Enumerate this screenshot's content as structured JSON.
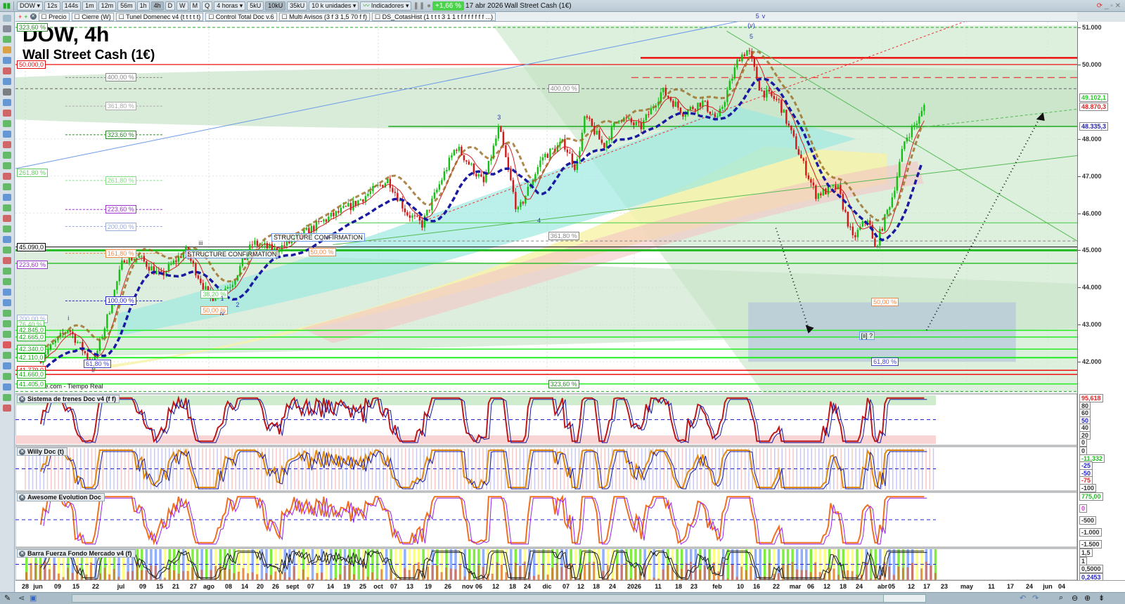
{
  "toolbar": {
    "symbol": "DOW",
    "intervals": [
      "12s",
      "144s",
      "1m",
      "12m",
      "56m",
      "1h",
      "4h",
      "D",
      "W",
      "M",
      "Q"
    ],
    "active_interval": "4h",
    "period": "4 horas",
    "units_buttons": [
      "5kU",
      "10kU",
      "35kU"
    ],
    "active_units": "10kU",
    "units": "10 k unidades",
    "indicators": "Indicadores",
    "change": "+1,66 %",
    "date": "17 abr 2026",
    "instrument": "Wall Street Cash (1€)"
  },
  "indicators_bar": [
    "Precio",
    "Cierre (W)",
    "Tunel Domenec v4 (t t t t t)",
    "Control Total Doc v.6",
    "Multi Avisos (3 f 3 1,5 70 f f)",
    "DS_CotasHist (1 t t t 3 1 1 t f f f f f f f ...)"
  ],
  "chart": {
    "title": "DOW, 4h",
    "subtitle": "Wall Street Cash (1€)",
    "source": "IT-Finance.com - Tiempo Real"
  },
  "colors": {
    "up": "#16c016",
    "down": "#d01818",
    "accent_green": "#22dd22",
    "red_line": "#ee1111",
    "blue_trend": "#1a1aa0",
    "ma_brown": "#9a6a20"
  },
  "left_labels": [
    {
      "text": "323,60 %",
      "price": 51000,
      "color": "#2a8a2a"
    },
    {
      "text": "50.000,0",
      "price": 50000,
      "color": "#e01010"
    },
    {
      "text": "261,80 %",
      "price": 47080,
      "color": "#66cc66"
    },
    {
      "text": "45.090,0",
      "price": 45090,
      "color": "#000000"
    },
    {
      "text": "223,60 %",
      "price": 44620,
      "color": "#9933cc"
    },
    {
      "text": "200,00 %",
      "price": 43160,
      "color": "#99aadd"
    },
    {
      "text": "76,40 %",
      "price": 43010,
      "color": "#66cc66"
    },
    {
      "text": "42.845,0",
      "price": 42845,
      "color": "#22aa22"
    },
    {
      "text": "42.665,0",
      "price": 42665,
      "color": "#22aa22"
    },
    {
      "text": "42.340,0",
      "price": 42340,
      "color": "#22aa22"
    },
    {
      "text": "42.110,0",
      "price": 42110,
      "color": "#22aa22"
    },
    {
      "text": "41.770,0",
      "price": 41770,
      "color": "#e01010"
    },
    {
      "text": "41.660,0",
      "price": 41660,
      "color": "#22aa22"
    },
    {
      "text": "41.405,0",
      "price": 41405,
      "color": "#22aa22"
    }
  ],
  "fib_labels": [
    {
      "text": "400,00 %",
      "price": 49650,
      "t": 26,
      "color": "#888888"
    },
    {
      "text": "361,80 %",
      "price": 48880,
      "t": 26,
      "color": "#aaaaaa"
    },
    {
      "text": "323,60 %",
      "price": 48110,
      "t": 26,
      "color": "#2a8a2a"
    },
    {
      "text": "261,80 %",
      "price": 46880,
      "t": 26,
      "color": "#88dd88"
    },
    {
      "text": "223,60 %",
      "price": 46100,
      "t": 26,
      "color": "#9933cc"
    },
    {
      "text": "200,00 %",
      "price": 45640,
      "t": 26,
      "color": "#99aadd"
    },
    {
      "text": "161,80 %",
      "price": 44920,
      "t": 26,
      "color": "#ee8844"
    },
    {
      "text": "100,00 %",
      "price": 43640,
      "t": 26,
      "color": "#2222cc"
    },
    {
      "text": "38,20 %",
      "price": 43820,
      "t": 57,
      "color": "#66cc66"
    },
    {
      "text": "50,00 %",
      "price": 43380,
      "t": 57,
      "color": "#ee8844"
    },
    {
      "text": "61,80 %",
      "price": 41950,
      "t": 19,
      "color": "#4444cc"
    },
    {
      "text": "50,00 %",
      "price": 44960,
      "t": 92,
      "color": "#ee8844"
    },
    {
      "text": "400,00 %",
      "price": 49350,
      "t": 170,
      "color": "#888888"
    },
    {
      "text": "361,80 %",
      "price": 45380,
      "t": 170,
      "color": "#888888"
    },
    {
      "text": "323,60 %",
      "price": 41400,
      "t": 170,
      "color": "#2a8a2a"
    },
    {
      "text": "50,00 %",
      "price": 43600,
      "t": 275,
      "color": "#ee8844"
    },
    {
      "text": "61,80 %",
      "price": 42000,
      "t": 275,
      "color": "#4444cc"
    }
  ],
  "annotations": [
    {
      "text": "STRUCTURE CONFIRMATION",
      "t": 52,
      "price": 44900
    },
    {
      "text": "STRUCTURE CONFIRMATION",
      "t": 80,
      "price": 45350
    },
    {
      "text": "[ii] ?",
      "t": 271,
      "price": 42700
    }
  ],
  "wave_labels": [
    {
      "text": "i",
      "t": 14,
      "price": 43180
    },
    {
      "text": "ii",
      "t": 22,
      "price": 41770
    },
    {
      "text": "iii",
      "t": 57,
      "price": 45200
    },
    {
      "text": "iv",
      "t": 64,
      "price": 43310
    },
    {
      "text": "1",
      "t": 64,
      "price": 43700
    },
    {
      "text": "2",
      "t": 69,
      "price": 43530
    },
    {
      "text": "3",
      "t": 154,
      "price": 48580
    },
    {
      "text": "4",
      "t": 167,
      "price": 45800
    },
    {
      "text": "5",
      "t": 236,
      "price": 50750
    },
    {
      "text": "(v)",
      "t": 236,
      "price": 51050
    },
    {
      "text": "5",
      "t": 238,
      "price": 51300
    },
    {
      "text": "v",
      "t": 240,
      "price": 51310
    }
  ],
  "price_axis": {
    "ticks": [
      "51.000",
      "50.000",
      "48.000",
      "47.000",
      "46.000",
      "45.000",
      "44.000",
      "43.000",
      "42.000"
    ],
    "tick_values": [
      51000,
      50000,
      48000,
      47000,
      46000,
      45000,
      44000,
      43000,
      42000
    ],
    "badges": [
      {
        "text": "49.102,1",
        "price": 49102,
        "color": "#22cc22"
      },
      {
        "text": "48.870,3",
        "price": 48870,
        "color": "#dd2222"
      },
      {
        "text": "48.335,3",
        "price": 48335,
        "color": "#2222aa"
      }
    ]
  },
  "panels": [
    {
      "title": "Sistema de trenes Doc v4 (f f)",
      "axis": [
        "95,618",
        "80",
        "60",
        "50",
        "40",
        "20",
        "0"
      ],
      "axis_colors": [
        "#dd2222",
        "#333",
        "#333",
        "#2222cc",
        "#333",
        "#333",
        "#333"
      ]
    },
    {
      "title": "Willy Doc (t)",
      "axis": [
        "0",
        "-11,332",
        "-25",
        "-50",
        "-75",
        "-100"
      ],
      "axis_colors": [
        "#333",
        "#22bb22",
        "#2222cc",
        "#2222cc",
        "#dd2222",
        "#333"
      ]
    },
    {
      "title": "Awesome Evolution Doc",
      "axis": [
        "775,00",
        "0",
        "-500",
        "-1.000",
        "-1.500"
      ],
      "axis_colors": [
        "#22bb22",
        "#ee22ee",
        "#333",
        "#333",
        "#333"
      ]
    },
    {
      "title": "Barra Fuerza Fondo Mercado v4 (f)",
      "axis": [
        "1,5",
        "1",
        "0,5000",
        "0,2453"
      ],
      "axis_colors": [
        "#333",
        "#333",
        "#333",
        "#2222cc"
      ]
    }
  ],
  "date_labels": [
    "28",
    "jun",
    "09",
    "15",
    "22",
    "jul",
    "09",
    "15",
    "21",
    "27",
    "ago",
    "08",
    "14",
    "20",
    "26",
    "sept",
    "07",
    "14",
    "19",
    "25",
    "oct",
    "07",
    "13",
    "19",
    "26",
    "nov",
    "06",
    "12",
    "18",
    "24",
    "dic",
    "07",
    "12",
    "18",
    "24",
    "2026",
    "11",
    "18",
    "23",
    "feb",
    "10",
    "16",
    "22",
    "mar",
    "06",
    "12",
    "18",
    "24",
    "abr",
    "05",
    "12",
    "17",
    "23",
    "may",
    "11",
    "17",
    "24",
    "jun",
    "04"
  ],
  "chart_data": {
    "type": "candlestick",
    "title": "DOW, 4h",
    "subtitle": "Wall Street Cash (1€)",
    "x_unit": "days since 28 jun 2025",
    "ylim": [
      41000,
      51500
    ],
    "price_path": [
      [
        5,
        42100
      ],
      [
        14,
        42900
      ],
      [
        22,
        41900
      ],
      [
        26,
        43000
      ],
      [
        32,
        44800
      ],
      [
        37,
        44800
      ],
      [
        44,
        44300
      ],
      [
        52,
        45000
      ],
      [
        60,
        43700
      ],
      [
        67,
        44100
      ],
      [
        74,
        45200
      ],
      [
        81,
        45000
      ],
      [
        88,
        45300
      ],
      [
        97,
        45800
      ],
      [
        106,
        46200
      ],
      [
        118,
        46900
      ],
      [
        124,
        46000
      ],
      [
        129,
        45700
      ],
      [
        140,
        47800
      ],
      [
        149,
        46800
      ],
      [
        154,
        48300
      ],
      [
        160,
        46000
      ],
      [
        168,
        47500
      ],
      [
        175,
        47900
      ],
      [
        179,
        47200
      ],
      [
        182,
        48600
      ],
      [
        188,
        47800
      ],
      [
        193,
        48600
      ],
      [
        200,
        48300
      ],
      [
        207,
        49300
      ],
      [
        214,
        48700
      ],
      [
        220,
        49000
      ],
      [
        225,
        48500
      ],
      [
        232,
        50200
      ],
      [
        235,
        50400
      ],
      [
        239,
        49300
      ],
      [
        245,
        49000
      ],
      [
        252,
        47500
      ],
      [
        257,
        46500
      ],
      [
        264,
        46700
      ],
      [
        269,
        45300
      ],
      [
        274,
        45900
      ],
      [
        276,
        45000
      ],
      [
        282,
        46500
      ],
      [
        286,
        48000
      ],
      [
        291,
        48600
      ],
      [
        293,
        49102
      ]
    ],
    "last": 49102.1
  }
}
